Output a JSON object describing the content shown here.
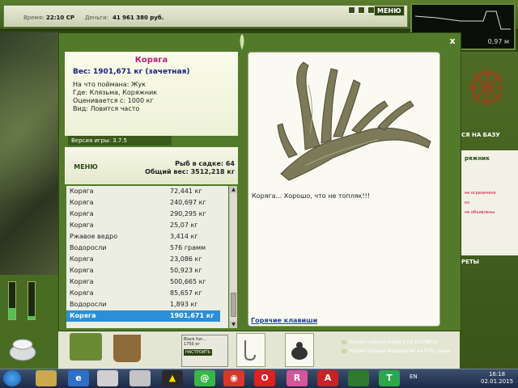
{
  "topbar": {
    "time_label": "Время:",
    "time_value": "22:10 СР",
    "money_label": "Деньги:",
    "money_value": "41 961 380 руб.",
    "menu_label": "МЕНЮ"
  },
  "depth": {
    "value": "0,97 м"
  },
  "side": {
    "base_label": "СЯ НА БАЗУ",
    "fisher_label": "ряжник",
    "note1": "не ограничено",
    "note2": "ко",
    "note3": "не объявлены",
    "rockets_label": "РЕТЫ"
  },
  "items": {
    "lure_title": "Black fun...",
    "lure_weight": "1750 кг",
    "lure_button": "НАСТРОИТЬ"
  },
  "right_notes": [
    "Колян поймал Корягу на 23,086 кг",
    "Колян поймал Водоросли на 576 грами"
  ],
  "dialog": {
    "fish_name": "Коряга",
    "weight": "Вес: 1901,671 кг (зачетная)",
    "caught_on": "На что поймана: Жук",
    "where": "Где: Клязьма, Коряжник",
    "valued_from": "Оценивается с: 1000 кг",
    "kind": "Вид: Ловится часто",
    "version": "Версия игры: 3.7.5",
    "menu_label": "МЕНЮ",
    "fish_in_keepnet": "Рыб в садке: 64",
    "total_weight": "Общий вес: 3512,218 кг",
    "caption": "Коряга... Хорошо, что не топляк!!!",
    "hotkeys": "Горячие клавиши",
    "catch_list": [
      {
        "name": "Коряга",
        "weight": "72,441 кг"
      },
      {
        "name": "Коряга",
        "weight": "240,697 кг"
      },
      {
        "name": "Коряга",
        "weight": "290,295 кг"
      },
      {
        "name": "Коряга",
        "weight": "25,07 кг"
      },
      {
        "name": "Ржавое ведро",
        "weight": "3,414 кг"
      },
      {
        "name": "Водоросли",
        "weight": "576 грамм"
      },
      {
        "name": "Коряга",
        "weight": "23,086 кг"
      },
      {
        "name": "Коряга",
        "weight": "50,923 кг"
      },
      {
        "name": "Коряга",
        "weight": "500,665 кг"
      },
      {
        "name": "Коряга",
        "weight": "85,657 кг"
      },
      {
        "name": "Водоросли",
        "weight": "1,893 кг"
      },
      {
        "name": "Коряга",
        "weight": "1901,671 кг"
      }
    ]
  },
  "taskbar": {
    "lang": "EN",
    "time": "16:18",
    "date": "02.01.2015",
    "colors": {
      "accent": "#2a8fd8",
      "dialog_green": "#537a2a",
      "fish_name": "#b41f7a"
    }
  }
}
